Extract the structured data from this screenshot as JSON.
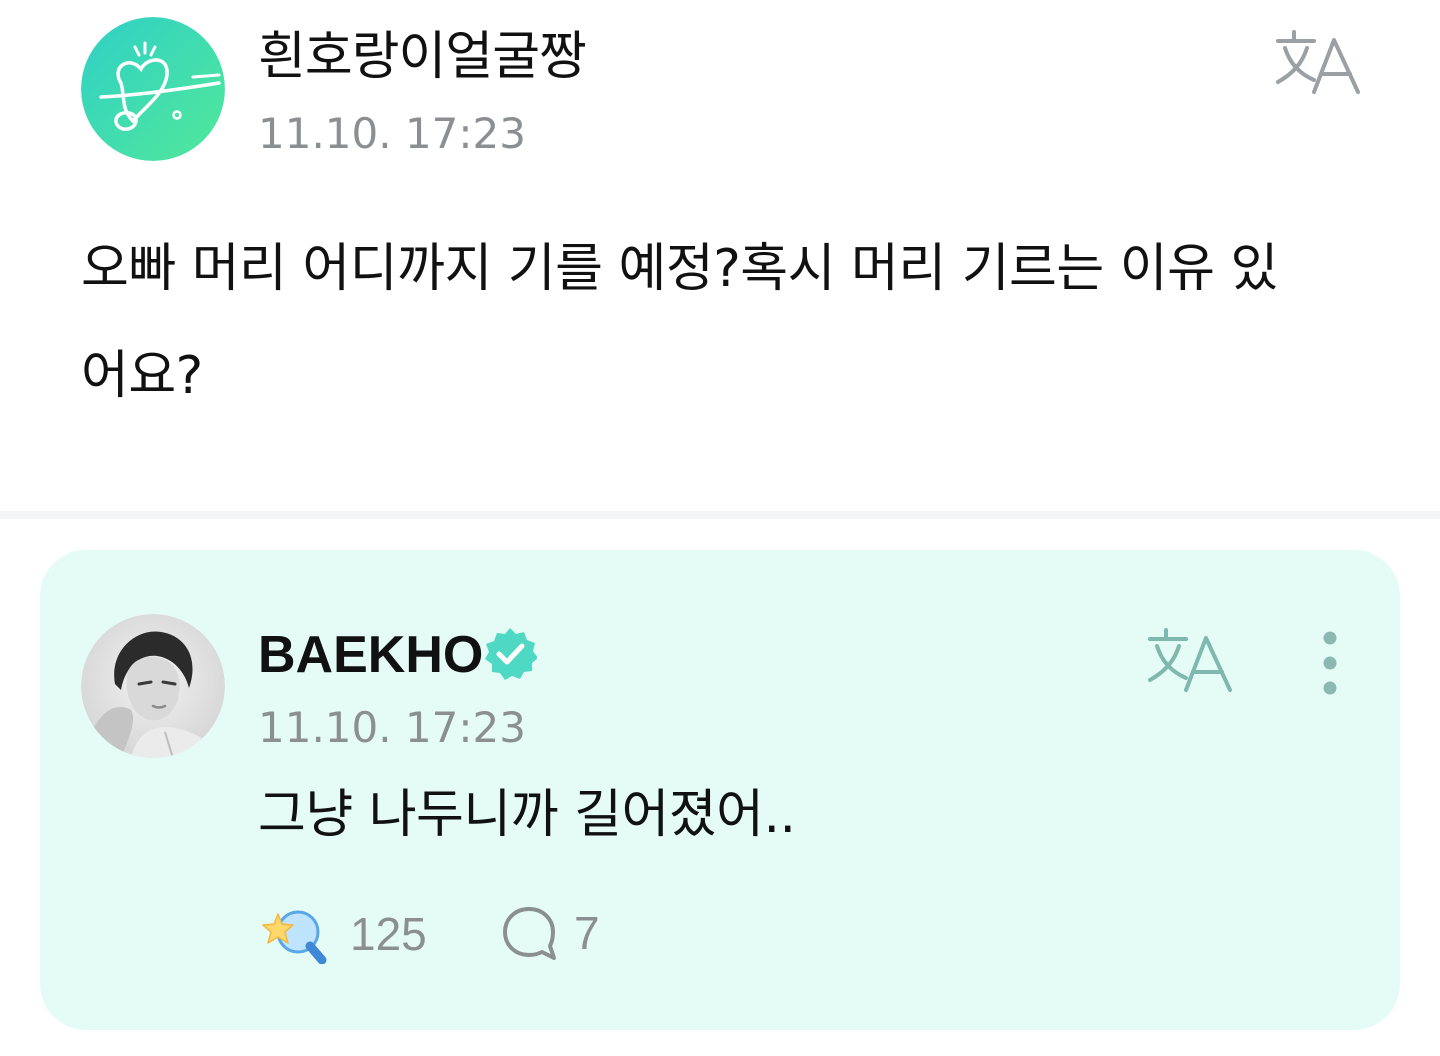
{
  "post": {
    "author": "흰호랑이얼굴짱",
    "time": "11.10. 17:23",
    "body": "오빠 머리 어디까지 기를 예정?혹시 머리 기르는 이유 있어요?"
  },
  "reply": {
    "author": "BAEKHO",
    "time": "11.10. 17:23",
    "body": "그냥 나두니까 길어졌어..",
    "like_count": "125",
    "comment_count": "7"
  },
  "icons": {
    "translate": "translate-icon",
    "more": "more-vertical-icon",
    "verified": "verified-badge-icon",
    "like": "star-lightstick-icon",
    "comment": "speech-bubble-icon"
  },
  "colors": {
    "accent": "#4fd9c4",
    "card_bg": "#e5fcf6",
    "muted_text": "#8b8f92",
    "translate_fan": "#9aa0a4",
    "translate_artist": "#7fb8ae"
  }
}
